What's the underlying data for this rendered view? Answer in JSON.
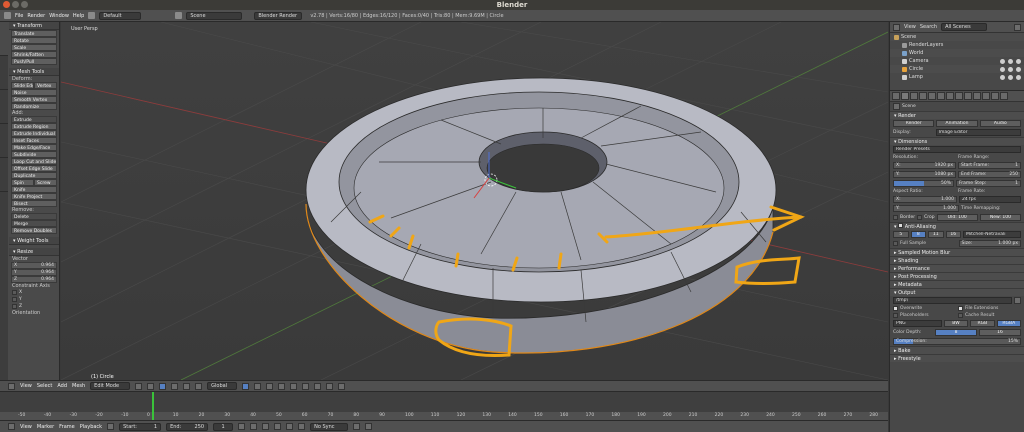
{
  "window": {
    "title": "Blender"
  },
  "infobar": {
    "menus": [
      "File",
      "Render",
      "Window",
      "Help"
    ],
    "layout": "Default",
    "scene": "Scene",
    "engine": "Blender Render",
    "stats": "v2.78 | Verts:16/80 | Edges:16/120 | Faces:0/40 | Tris:80 | Mem:9.69M | Circle"
  },
  "toolshelf": {
    "transform": {
      "title": "Transform",
      "items": [
        "Translate",
        "Rotate",
        "Scale",
        "Shrink/Fatten",
        "Push/Pull"
      ]
    },
    "mesh_tools": {
      "title": "Mesh Tools",
      "deform_label": "Deform:",
      "slide_row": [
        "Slide Edge",
        "Vertex"
      ],
      "deform_items": [
        "Noise",
        "Smooth Vertex",
        "Randomize"
      ],
      "add_label": "Add:",
      "add_items": [
        "Extrude",
        "Extrude Region",
        "Extrude Individual",
        "Inset Faces",
        "Make Edge/Face",
        "Subdivide",
        "Loop Cut and Slide",
        "Offset Edge Slide",
        "Duplicate"
      ],
      "spin_row": [
        "Spin",
        "Screw"
      ],
      "add_more": [
        "Knife",
        "Knife Project",
        "Bisect"
      ],
      "remove_label": "Remove:",
      "remove_items": [
        "Delete",
        "Merge",
        "Remove Doubles"
      ]
    },
    "weight_tools": {
      "title": "Weight Tools"
    },
    "resize": {
      "title": "Resize",
      "vector_label": "Vector",
      "vector": [
        {
          "axis": "X",
          "value": "0.964"
        },
        {
          "axis": "Y",
          "value": "0.964"
        },
        {
          "axis": "Z",
          "value": "0.964"
        }
      ],
      "constraint_label": "Constraint Axis",
      "constraints": [
        "X",
        "Y",
        "Z"
      ],
      "orientation_label": "Orientation"
    }
  },
  "viewport": {
    "label": "User Persp",
    "object_label": "(1) Circle"
  },
  "view_header": {
    "menus": [
      "View",
      "Select",
      "Add",
      "Mesh"
    ],
    "mode": "Edit Mode",
    "orientation": "Global"
  },
  "timeline": {
    "ticks": [
      "-50",
      "-40",
      "-30",
      "-20",
      "-10",
      "0",
      "10",
      "20",
      "30",
      "40",
      "50",
      "60",
      "70",
      "80",
      "90",
      "100",
      "110",
      "120",
      "130",
      "140",
      "150",
      "160",
      "170",
      "180",
      "190",
      "200",
      "210",
      "220",
      "230",
      "240",
      "250",
      "260",
      "270",
      "280"
    ],
    "current_frame": 1
  },
  "timeline_header": {
    "menus": [
      "View",
      "Marker",
      "Frame",
      "Playback"
    ],
    "start_label": "Start:",
    "start": "1",
    "end_label": "End:",
    "end": "250",
    "current": "1",
    "sync": "No Sync"
  },
  "outliner": {
    "view": "View",
    "search": "Search",
    "filter": "All Scenes",
    "items": [
      {
        "name": "Scene",
        "indent": 0,
        "color": "#c7a15a"
      },
      {
        "name": "RenderLayers",
        "indent": 1,
        "color": "#9a9a9a"
      },
      {
        "name": "World",
        "indent": 1,
        "color": "#7aa1c9"
      },
      {
        "name": "Camera",
        "indent": 1,
        "color": "#d0d0d0"
      },
      {
        "name": "Circle",
        "indent": 1,
        "color": "#e7a33c"
      },
      {
        "name": "Lamp",
        "indent": 1,
        "color": "#d0d0d0"
      }
    ]
  },
  "properties": {
    "scene": "Scene",
    "render_panel": "Render",
    "render_buttons": [
      "Render",
      "Animation",
      "Audio"
    ],
    "display_label": "Display:",
    "display_value": "Image Editor",
    "dimensions_panel": "Dimensions",
    "render_presets": "Render Presets",
    "resolution_label": "Resolution:",
    "res_x": "1920 px",
    "res_y": "1080 px",
    "res_pct": "50%",
    "frame_range_label": "Frame Range:",
    "start_frame": "1",
    "end_frame": "250",
    "frame_step": "1",
    "aspect_label": "Aspect Ratio:",
    "aspect_x": "1.000",
    "aspect_y": "1.000",
    "frame_rate_label": "Frame Rate:",
    "frame_rate": "24 fps",
    "time_remap_label": "Time Remapping:",
    "remap_old": "Old: 100",
    "remap_new": "New: 100",
    "border_label": "Border",
    "crop_label": "Crop",
    "aa_panel": "Anti-Aliasing",
    "aa_samples": [
      "5",
      "8",
      "11",
      "16"
    ],
    "aa_filter": "Mitchell-Netravali",
    "full_sample": "Full Sample",
    "size_label": "Size:",
    "size_value": "1.000 px",
    "collapsed_panels": [
      "Sampled Motion Blur",
      "Shading",
      "Performance",
      "Post Processing",
      "Metadata"
    ],
    "output_panel": "Output",
    "output_path": "/tmp\\",
    "overwrite": "Overwrite",
    "file_ext": "File Extensions",
    "placeholders": "Placeholders",
    "cache_result": "Cache Result",
    "format": "PNG",
    "color_modes": [
      "BW",
      "RGB",
      "RGBA"
    ],
    "color_depth_label": "Color Depth:",
    "depths": [
      "8",
      "16"
    ],
    "compression_label": "Compression:",
    "compression_value": "15%",
    "compression_pct": 15,
    "tail_panels": [
      "Bake",
      "Freestyle"
    ]
  }
}
